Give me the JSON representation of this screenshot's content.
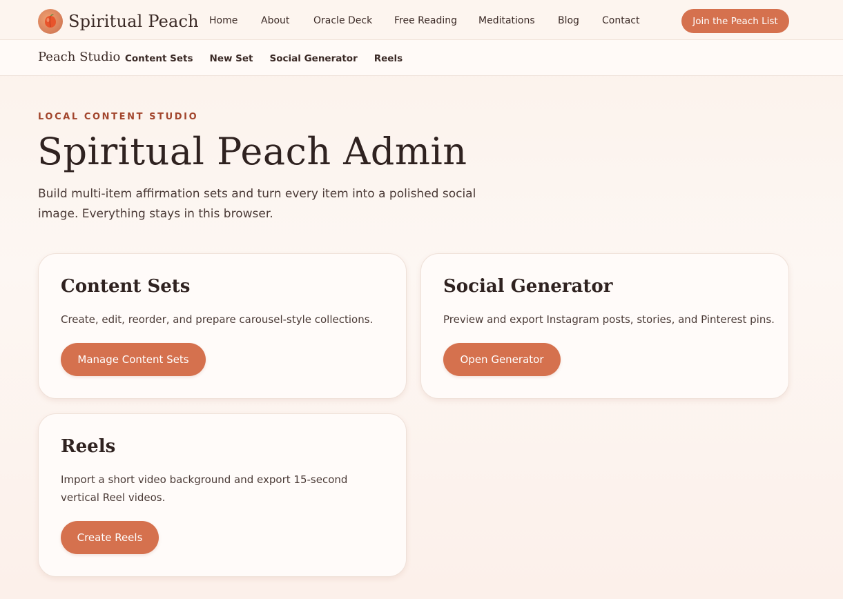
{
  "header": {
    "brand_name": "Spiritual Peach",
    "logo_icon": "peach-icon",
    "nav": [
      "Home",
      "About",
      "Oracle Deck",
      "Free Reading",
      "Meditations",
      "Blog",
      "Contact"
    ],
    "cta_label": "Join the Peach List"
  },
  "subnav": {
    "title": "Peach Studio",
    "links": [
      "Content Sets",
      "New Set",
      "Social Generator",
      "Reels"
    ]
  },
  "hero": {
    "eyebrow": "LOCAL CONTENT STUDIO",
    "title": "Spiritual Peach Admin",
    "lede": "Build multi-item affirmation sets and turn every item into a polished social image. Everything stays in this browser."
  },
  "cards": [
    {
      "title": "Content Sets",
      "description": "Create, edit, reorder, and prepare carousel-style collections.",
      "button_label": "Manage Content Sets"
    },
    {
      "title": "Social Generator",
      "description": "Preview and export Instagram posts, stories, and Pinterest pins.",
      "button_label": "Open Generator"
    },
    {
      "title": "Reels",
      "description": "Import a short video background and export 15-second vertical Reel videos.",
      "button_label": "Create Reels"
    }
  ],
  "colors": {
    "accent": "#d5714e",
    "eyebrow": "#a2452c",
    "text": "#3b2a26",
    "background": "#fcf3ee"
  }
}
